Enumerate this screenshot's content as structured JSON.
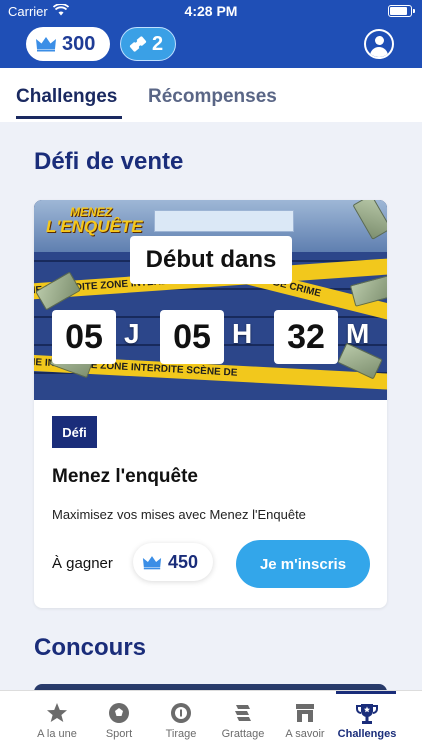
{
  "status_bar": {
    "carrier": "Carrier",
    "time": "4:28 PM"
  },
  "header": {
    "crowns": "300",
    "tickets": "2",
    "colors": {
      "bar": "#1f4fb6",
      "ticket": "#3aa0e6"
    }
  },
  "tabs": [
    {
      "label": "Challenges",
      "active": true
    },
    {
      "label": "Récompenses",
      "active": false
    }
  ],
  "sections": {
    "sales": "Défi de vente",
    "contest": "Concours"
  },
  "card": {
    "logo_line1": "MENEZ",
    "logo_line2": "L'ENQUÊTE",
    "starts_label": "Début dans",
    "countdown": [
      {
        "value": "05",
        "unit": "J"
      },
      {
        "value": "05",
        "unit": "H"
      },
      {
        "value": "32",
        "unit": "M"
      }
    ],
    "tape_text_1": "ZONE INTERDITE   ZONE INTERDITE   SCÈNE DE",
    "tape_text_2": "ZONE INTERDITE   ZONE INTERDITE   SCÈNE DE",
    "tape_text_3": "SCÈNE DE CRIME",
    "badge": "Défi",
    "title": "Menez l'enquête",
    "description": "Maximisez vos mises avec Menez l'Enquête",
    "win_label": "À gagner",
    "win_amount": "450",
    "cta": "Je m'inscris",
    "colors": {
      "cta": "#33a6ea",
      "navy": "#1a2d7a"
    }
  },
  "bottom_nav": [
    {
      "label": "A la une",
      "icon": "star-icon",
      "active": false
    },
    {
      "label": "Sport",
      "icon": "soccer-ball-icon",
      "active": false
    },
    {
      "label": "Tirage",
      "icon": "lottery-ball-icon",
      "active": false
    },
    {
      "label": "Grattage",
      "icon": "scratch-icon",
      "active": false
    },
    {
      "label": "A savoir",
      "icon": "store-icon",
      "active": false
    },
    {
      "label": "Challenges",
      "icon": "trophy-icon",
      "active": true
    }
  ]
}
